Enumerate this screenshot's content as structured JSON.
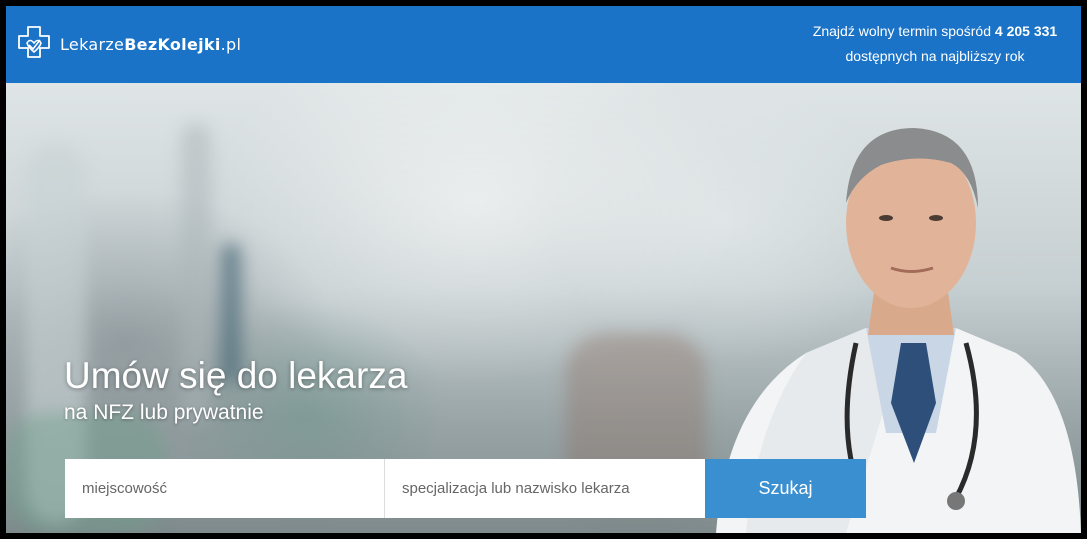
{
  "header": {
    "logo": {
      "text_regular": "Lekarze",
      "text_bold": "BezKolejki",
      "text_suffix": ".pl",
      "icon": "medical-cross-heart-icon"
    },
    "tagline": {
      "line1_prefix": "Znajdź wolny termin spośród ",
      "count": "4 205 331",
      "line2": "dostępnych na najbliższy rok"
    },
    "color": "#1a73c6"
  },
  "hero": {
    "title": "Umów się do lekarza",
    "subtitle": "na NFZ lub prywatnie"
  },
  "search": {
    "city_placeholder": "miejscowość",
    "specialization_placeholder": "specjalizacja lub nazwisko lekarza",
    "button_label": "Szukaj",
    "button_color": "#3a8fd0"
  }
}
